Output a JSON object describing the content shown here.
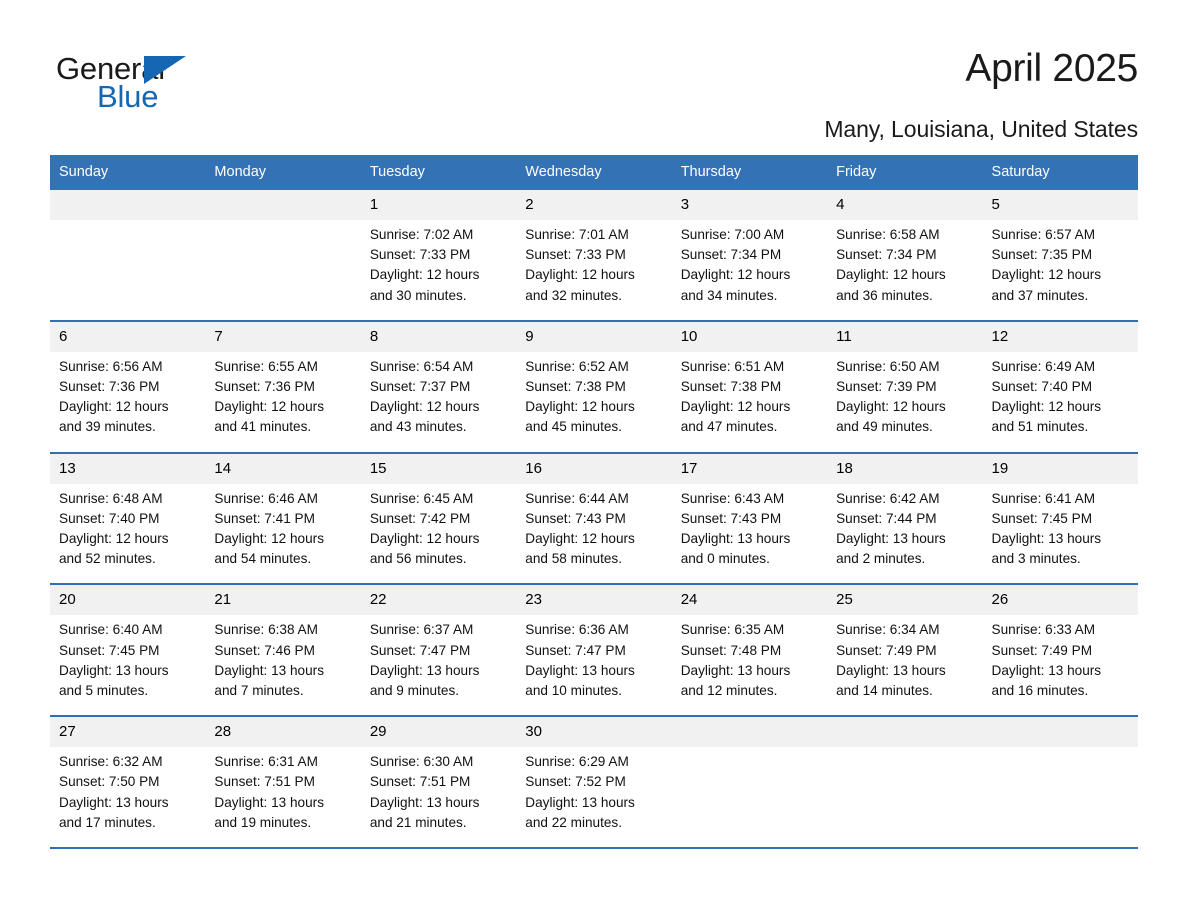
{
  "brand": {
    "name_part1": "General",
    "name_part2": "Blue",
    "logo_icon": "triangle-logo-icon",
    "accent_color": "#1567b3"
  },
  "header": {
    "month_title": "April 2025",
    "location": "Many, Louisiana, United States"
  },
  "theme": {
    "header_bg": "#3372b5",
    "rule_color": "#2e6fb7",
    "daynum_bg": "#f1f1f1",
    "cell_bg": "#ffffff",
    "text_color": "#111111"
  },
  "calendar": {
    "weekday_headers": [
      "Sunday",
      "Monday",
      "Tuesday",
      "Wednesday",
      "Thursday",
      "Friday",
      "Saturday"
    ],
    "weeks": [
      {
        "days": [
          {
            "num": "",
            "lines": [
              "",
              "",
              "",
              ""
            ],
            "empty": true
          },
          {
            "num": "",
            "lines": [
              "",
              "",
              "",
              ""
            ],
            "empty": true
          },
          {
            "num": "1",
            "lines": [
              "Sunrise: 7:02 AM",
              "Sunset: 7:33 PM",
              "Daylight: 12 hours",
              "and 30 minutes."
            ],
            "empty": false
          },
          {
            "num": "2",
            "lines": [
              "Sunrise: 7:01 AM",
              "Sunset: 7:33 PM",
              "Daylight: 12 hours",
              "and 32 minutes."
            ],
            "empty": false
          },
          {
            "num": "3",
            "lines": [
              "Sunrise: 7:00 AM",
              "Sunset: 7:34 PM",
              "Daylight: 12 hours",
              "and 34 minutes."
            ],
            "empty": false
          },
          {
            "num": "4",
            "lines": [
              "Sunrise: 6:58 AM",
              "Sunset: 7:34 PM",
              "Daylight: 12 hours",
              "and 36 minutes."
            ],
            "empty": false
          },
          {
            "num": "5",
            "lines": [
              "Sunrise: 6:57 AM",
              "Sunset: 7:35 PM",
              "Daylight: 12 hours",
              "and 37 minutes."
            ],
            "empty": false
          }
        ]
      },
      {
        "days": [
          {
            "num": "6",
            "lines": [
              "Sunrise: 6:56 AM",
              "Sunset: 7:36 PM",
              "Daylight: 12 hours",
              "and 39 minutes."
            ],
            "empty": false
          },
          {
            "num": "7",
            "lines": [
              "Sunrise: 6:55 AM",
              "Sunset: 7:36 PM",
              "Daylight: 12 hours",
              "and 41 minutes."
            ],
            "empty": false
          },
          {
            "num": "8",
            "lines": [
              "Sunrise: 6:54 AM",
              "Sunset: 7:37 PM",
              "Daylight: 12 hours",
              "and 43 minutes."
            ],
            "empty": false
          },
          {
            "num": "9",
            "lines": [
              "Sunrise: 6:52 AM",
              "Sunset: 7:38 PM",
              "Daylight: 12 hours",
              "and 45 minutes."
            ],
            "empty": false
          },
          {
            "num": "10",
            "lines": [
              "Sunrise: 6:51 AM",
              "Sunset: 7:38 PM",
              "Daylight: 12 hours",
              "and 47 minutes."
            ],
            "empty": false
          },
          {
            "num": "11",
            "lines": [
              "Sunrise: 6:50 AM",
              "Sunset: 7:39 PM",
              "Daylight: 12 hours",
              "and 49 minutes."
            ],
            "empty": false
          },
          {
            "num": "12",
            "lines": [
              "Sunrise: 6:49 AM",
              "Sunset: 7:40 PM",
              "Daylight: 12 hours",
              "and 51 minutes."
            ],
            "empty": false
          }
        ]
      },
      {
        "days": [
          {
            "num": "13",
            "lines": [
              "Sunrise: 6:48 AM",
              "Sunset: 7:40 PM",
              "Daylight: 12 hours",
              "and 52 minutes."
            ],
            "empty": false
          },
          {
            "num": "14",
            "lines": [
              "Sunrise: 6:46 AM",
              "Sunset: 7:41 PM",
              "Daylight: 12 hours",
              "and 54 minutes."
            ],
            "empty": false
          },
          {
            "num": "15",
            "lines": [
              "Sunrise: 6:45 AM",
              "Sunset: 7:42 PM",
              "Daylight: 12 hours",
              "and 56 minutes."
            ],
            "empty": false
          },
          {
            "num": "16",
            "lines": [
              "Sunrise: 6:44 AM",
              "Sunset: 7:43 PM",
              "Daylight: 12 hours",
              "and 58 minutes."
            ],
            "empty": false
          },
          {
            "num": "17",
            "lines": [
              "Sunrise: 6:43 AM",
              "Sunset: 7:43 PM",
              "Daylight: 13 hours",
              "and 0 minutes."
            ],
            "empty": false
          },
          {
            "num": "18",
            "lines": [
              "Sunrise: 6:42 AM",
              "Sunset: 7:44 PM",
              "Daylight: 13 hours",
              "and 2 minutes."
            ],
            "empty": false
          },
          {
            "num": "19",
            "lines": [
              "Sunrise: 6:41 AM",
              "Sunset: 7:45 PM",
              "Daylight: 13 hours",
              "and 3 minutes."
            ],
            "empty": false
          }
        ]
      },
      {
        "days": [
          {
            "num": "20",
            "lines": [
              "Sunrise: 6:40 AM",
              "Sunset: 7:45 PM",
              "Daylight: 13 hours",
              "and 5 minutes."
            ],
            "empty": false
          },
          {
            "num": "21",
            "lines": [
              "Sunrise: 6:38 AM",
              "Sunset: 7:46 PM",
              "Daylight: 13 hours",
              "and 7 minutes."
            ],
            "empty": false
          },
          {
            "num": "22",
            "lines": [
              "Sunrise: 6:37 AM",
              "Sunset: 7:47 PM",
              "Daylight: 13 hours",
              "and 9 minutes."
            ],
            "empty": false
          },
          {
            "num": "23",
            "lines": [
              "Sunrise: 6:36 AM",
              "Sunset: 7:47 PM",
              "Daylight: 13 hours",
              "and 10 minutes."
            ],
            "empty": false
          },
          {
            "num": "24",
            "lines": [
              "Sunrise: 6:35 AM",
              "Sunset: 7:48 PM",
              "Daylight: 13 hours",
              "and 12 minutes."
            ],
            "empty": false
          },
          {
            "num": "25",
            "lines": [
              "Sunrise: 6:34 AM",
              "Sunset: 7:49 PM",
              "Daylight: 13 hours",
              "and 14 minutes."
            ],
            "empty": false
          },
          {
            "num": "26",
            "lines": [
              "Sunrise: 6:33 AM",
              "Sunset: 7:49 PM",
              "Daylight: 13 hours",
              "and 16 minutes."
            ],
            "empty": false
          }
        ]
      },
      {
        "days": [
          {
            "num": "27",
            "lines": [
              "Sunrise: 6:32 AM",
              "Sunset: 7:50 PM",
              "Daylight: 13 hours",
              "and 17 minutes."
            ],
            "empty": false
          },
          {
            "num": "28",
            "lines": [
              "Sunrise: 6:31 AM",
              "Sunset: 7:51 PM",
              "Daylight: 13 hours",
              "and 19 minutes."
            ],
            "empty": false
          },
          {
            "num": "29",
            "lines": [
              "Sunrise: 6:30 AM",
              "Sunset: 7:51 PM",
              "Daylight: 13 hours",
              "and 21 minutes."
            ],
            "empty": false
          },
          {
            "num": "30",
            "lines": [
              "Sunrise: 6:29 AM",
              "Sunset: 7:52 PM",
              "Daylight: 13 hours",
              "and 22 minutes."
            ],
            "empty": false
          },
          {
            "num": "",
            "lines": [
              "",
              "",
              "",
              ""
            ],
            "empty": true
          },
          {
            "num": "",
            "lines": [
              "",
              "",
              "",
              ""
            ],
            "empty": true
          },
          {
            "num": "",
            "lines": [
              "",
              "",
              "",
              ""
            ],
            "empty": true
          }
        ]
      }
    ]
  }
}
